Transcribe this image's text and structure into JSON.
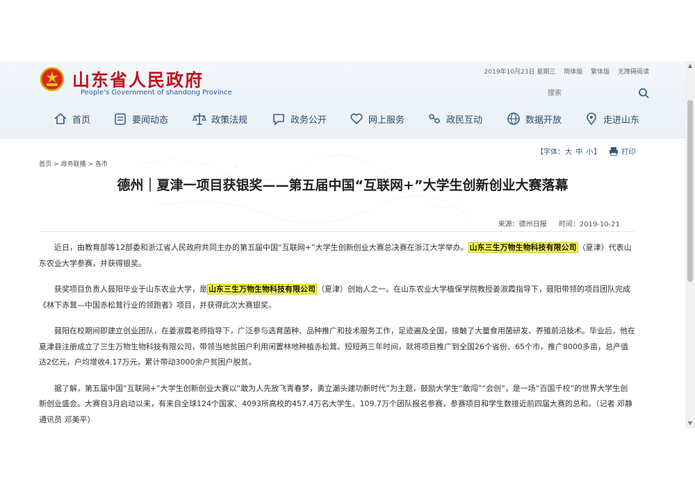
{
  "header": {
    "site_title": "山东省人民政府",
    "site_subtitle": "People's Government of shandong Province",
    "date_info": "2019年10月23日 星期三",
    "links": [
      "简体版",
      "繁体版",
      "无障碍阅读"
    ],
    "search_placeholder": "搜索"
  },
  "nav": {
    "items": [
      {
        "label": "首页",
        "icon": "home-icon"
      },
      {
        "label": "要闻动态",
        "icon": "news-icon"
      },
      {
        "label": "政策法规",
        "icon": "scales-icon"
      },
      {
        "label": "政务公开",
        "icon": "chat-icon"
      },
      {
        "label": "网上服务",
        "icon": "heart-icon"
      },
      {
        "label": "政民互动",
        "icon": "interact-icon"
      },
      {
        "label": "数据开放",
        "icon": "globe-icon"
      },
      {
        "label": "走进山东",
        "icon": "location-icon"
      }
    ]
  },
  "toolbar": {
    "font_prefix": "【字体：",
    "sizes": [
      "大",
      "中",
      "小"
    ],
    "font_suffix": "】",
    "print_label": "打印"
  },
  "breadcrumb": [
    "首页",
    "政务联播",
    "各市"
  ],
  "article": {
    "title": "德州｜夏津一项目获银奖——第五届中国“互联网+”大学生创新创业大赛落幕",
    "source": "来源：德州日报",
    "time": "时间：2019-10-21",
    "p1_a": "近日，由教育部等12部委和浙江省人民政府共同主办的第五届中国“互联网+”大学生创新创业大赛总决赛在浙江大学举办。",
    "p1_hl": "山东三生万物生物科技有限公司",
    "p1_b": "（夏津）代表山东农业大学参赛，并获得银奖。",
    "p2_a": "获奖项目负责人聂阳毕业于山东农业大学，是",
    "p2_hl": "山东三生万物生物科技有限公司",
    "p2_b": "（夏津）创始人之一。在山东农业大学植保学院教授姜淑霞指导下，聂阳带领的项目团队完成《林下赤茸—中国赤松茸行业的领跑者》项目，并获得此次大赛银奖。",
    "p3": "聂阳在校期间即建立创业团队，在姜淑霞老师指导下，广泛参与选育菌种、品种推广和技术服务工作，足迹遍及全国，接触了大量食用菌研发、养殖前沿技术。毕业后，他在夏津县注册成立了三生万物生物科技有限公司，带领当地贫困户利用闲置林地种植赤松茸。短短两三年时间，就将项目推广到全国26个省份、65个市，推广8000多亩，总产值达2亿元，户均增收4.17万元，累计带动3000余户贫困户脱贫。",
    "p4": "据了解，第五届中国“互联网+”大学生创新创业大赛以“敢为人先放飞青春梦，勇立潮头建功新时代”为主题，鼓励大学生“敢闯”“会创”，是一场“百国千校”的世界大学生创新创业盛会。大赛自3月启动以来，有来自全球124个国家、4093所高校的457.4万名大学生、109.7万个团队报名参赛，参赛项目和学生数接近前四届大赛的总和。（记者 邓静 通讯员 邓美平）"
  },
  "colors": {
    "title_red": "#c1121f",
    "nav_text": "#2e4a66",
    "highlight": "#ffff4d"
  }
}
